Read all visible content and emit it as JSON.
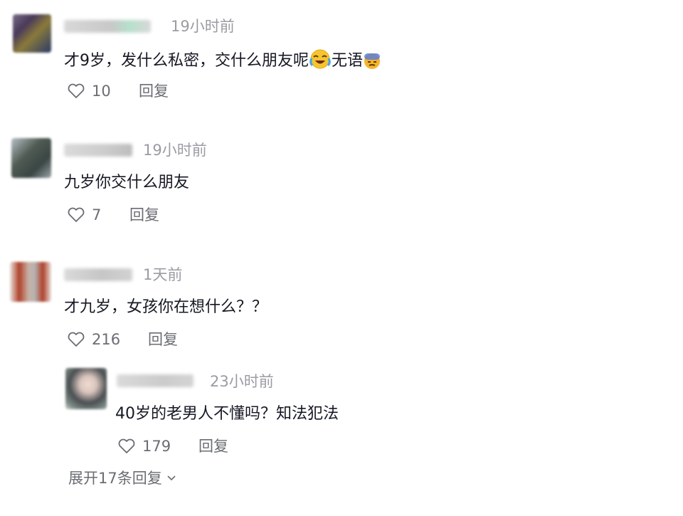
{
  "comments": [
    {
      "time": "19小时前",
      "text": "才9岁，发什么私密，交什么朋友呢",
      "text_suffix": "无语",
      "likes": "10",
      "reply_label": "回复",
      "emoji_1": "laughing-crying-emoji",
      "emoji_2": "sweat-emoji"
    },
    {
      "time": "19小时前",
      "text": "九岁你交什么朋友",
      "likes": "7",
      "reply_label": "回复"
    },
    {
      "time": "1天前",
      "text": "才九岁，女孩你在想什么？？",
      "likes": "216",
      "reply_label": "回复"
    }
  ],
  "reply": {
    "time": "23小时前",
    "text": "40岁的老男人不懂吗？知法犯法",
    "likes": "179",
    "reply_label": "回复"
  },
  "expand_label": "展开17条回复",
  "icons": {
    "like": "heart-outline-icon",
    "expand": "chevron-down-icon"
  },
  "colors": {
    "text": "#161823",
    "secondary": "#9a9ca3",
    "action": "#6b6d73"
  }
}
